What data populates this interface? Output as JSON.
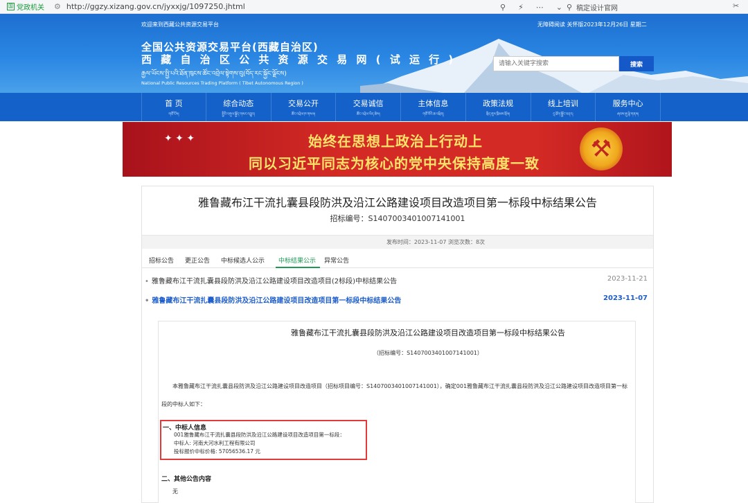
{
  "browser": {
    "gov_badge": "党政机关",
    "url": "http://ggzy.xizang.gov.cn/jyxxjg/1097250.jhtml",
    "search_text": "稿定设计官网"
  },
  "header": {
    "welcome": "欢迎来到西藏公共资源交易平台",
    "accessibility": "无障碍阅读 关怀版2023年12月26日 星期二",
    "title_line1": "全国公共资源交易平台(西藏自治区)",
    "title_line2": "西 藏 自 治 区 公 共 资 源 交 易 网 ( 试 运 行 )",
    "title_tibetan": "རྒྱལ་ཡོངས་སྤྱི་པའི་ཐོན་ཁུངས་ཚོང་འབྲེལ་སྟེགས་བུ(བོད་རང་སྐྱོང་ལྗོངས)",
    "title_english": "National Public Resources Trading Platform ( Tibet Autonomous Region )",
    "search_placeholder": "请输入关键字搜索",
    "search_button": "搜索"
  },
  "nav": [
    {
      "label": "首 页",
      "sub": "གཙོ་ངོས།"
    },
    {
      "label": "综合动态",
      "sub": "སྤྱིའི་འགུལ་སྐྱོད་གསར་འགྱུར།"
    },
    {
      "label": "交易公开",
      "sub": "ཚོང་འབྲེལ་ཁ་གསལ།"
    },
    {
      "label": "交易诚信",
      "sub": "ཚོང་འབྲེལ་ཡིད་ཆེས།"
    },
    {
      "label": "主体信息",
      "sub": "གཙོ་བོའི་ཆ་འཕྲིན།"
    },
    {
      "label": "政策法规",
      "sub": "སྲིད་ཇུས་ཁྲིམས་སྲོལ།"
    },
    {
      "label": "线上培训",
      "sub": "དྲ་ཐོག་སྦྱོང་བརྡར།"
    },
    {
      "label": "服务中心",
      "sub": "ཞབས་ཞུ་ལྟེ་གནས།"
    }
  ],
  "banner": {
    "line1": "始终在思想上政治上行动上",
    "line2": "同以习近平同志为核心的党中央保持高度一致"
  },
  "notice": {
    "title": "雅鲁藏布江干流扎囊县段防洪及沿江公路建设项目改造项目第一标段中标结果公告",
    "bid_no": "招标编号：S1407003401007141001",
    "meta": "发布时间：2023-11-07    浏览次数：8次"
  },
  "tabs": [
    {
      "label": "招标公告",
      "active": false
    },
    {
      "label": "更正公告",
      "active": false
    },
    {
      "label": "中标候选人公示",
      "active": false
    },
    {
      "label": "中标结果公示",
      "active": true
    },
    {
      "label": "异常公告",
      "active": false
    }
  ],
  "list": [
    {
      "title": "雅鲁藏布江干流扎囊县段防洪及沿江公路建设项目改造项目(2标段)中标结果公告",
      "date": "2023-11-21",
      "active": false
    },
    {
      "title": "雅鲁藏布江干流扎囊县段防洪及沿江公路建设项目改造项目第一标段中标结果公告",
      "date": "2023-11-07",
      "active": true
    }
  ],
  "doc": {
    "title": "雅鲁藏布江干流扎囊县段防洪及沿江公路建设项目改造项目第一标段中标结果公告",
    "bid_no": "（招标编号：S1407003401007141001）",
    "para1": "本雅鲁藏布江干流扎囊县段防洪及沿江公路建设项目改造项目（招标项目编号：S1407003401007141001），确定001雅鲁藏布江干流扎囊县段防洪及沿江公路建设项目改造项目第一标",
    "para2": "段的中标人如下：",
    "section1_heading": "一、中标人信息",
    "section1_lot": "001雅鲁藏布江干流扎囊县段防洪及沿江公路建设项目改造项目第一标段：",
    "section1_winner": "中标人: 河南大河水利工程有限公司",
    "section1_price": "投标报价中标价格: 57056536.17 元",
    "section2_heading": "二、其他公告内容",
    "section2_value": "无"
  }
}
